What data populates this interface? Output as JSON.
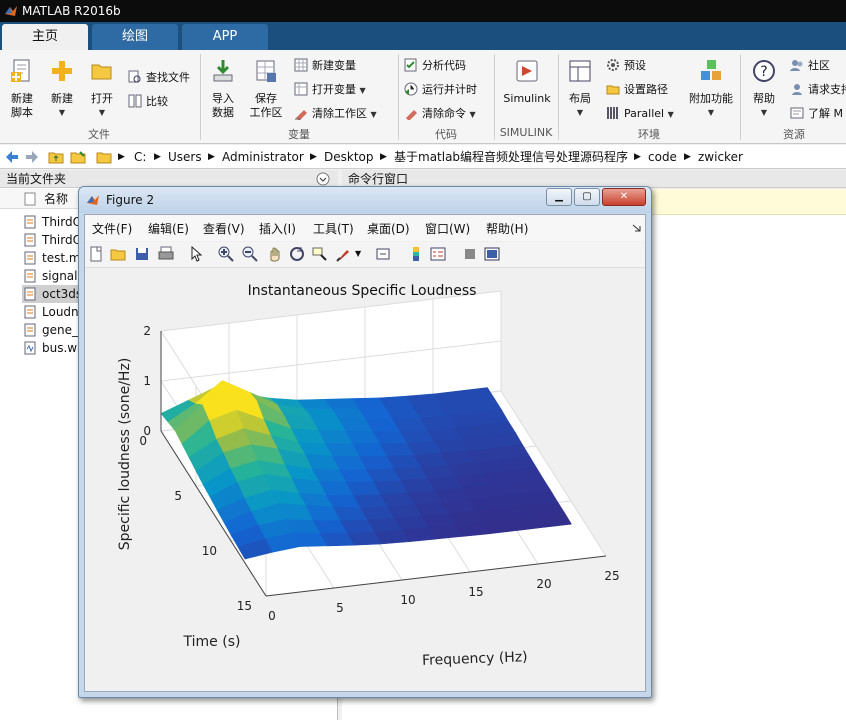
{
  "window": {
    "title": "MATLAB R2016b"
  },
  "tabs": [
    {
      "label": "主页",
      "active": true
    },
    {
      "label": "绘图",
      "active": false
    },
    {
      "label": "APP",
      "active": false
    }
  ],
  "ribbon": {
    "file": {
      "group_label": "文件",
      "new_script": [
        "新建",
        "脚本"
      ],
      "new": "新建",
      "open": "打开",
      "find_files": "查找文件",
      "compare": "比较"
    },
    "variable": {
      "group_label": "变量",
      "import": [
        "导入",
        "数据"
      ],
      "save_ws": [
        "保存",
        "工作区"
      ],
      "new_var": "新建变量",
      "open_var": "打开变量",
      "clear_ws": "清除工作区"
    },
    "code": {
      "group_label": "代码",
      "analyze": "分析代码",
      "run_time": "运行并计时",
      "clear_cmd": "清除命令"
    },
    "simulink": {
      "group_label": "SIMULINK",
      "label": "Simulink"
    },
    "env": {
      "group_label": "环境",
      "layout": "布局",
      "prefs": "预设",
      "set_path": "设置路径",
      "parallel": "Parallel",
      "addons": "附加功能"
    },
    "resources": {
      "group_label": "资源",
      "help": "帮助",
      "community": "社区",
      "request_support": "请求支持",
      "learn": "了解 M"
    }
  },
  "address": {
    "crumbs": [
      "C:",
      "Users",
      "Administrator",
      "Desktop",
      "基于matlab编程音频处理信号处理源码程序",
      "code",
      "zwicker"
    ]
  },
  "left_panel": {
    "title": "当前文件夹",
    "column_name": "名称",
    "files": [
      {
        "name": "ThirdO",
        "type": "m"
      },
      {
        "name": "ThirdO",
        "type": "m"
      },
      {
        "name": "test.m",
        "type": "m"
      },
      {
        "name": "signal",
        "type": "m"
      },
      {
        "name": "oct3ds",
        "type": "m",
        "selected": true
      },
      {
        "name": "Loudn",
        "type": "m"
      },
      {
        "name": "gene_",
        "type": "m"
      },
      {
        "name": "bus.wa",
        "type": "wav"
      }
    ]
  },
  "right_panel": {
    "title": "命令行窗口"
  },
  "figure": {
    "title": "Figure 2",
    "menus": [
      "文件(F)",
      "编辑(E)",
      "查看(V)",
      "插入(I)",
      "工具(T)",
      "桌面(D)",
      "窗口(W)",
      "帮助(H)"
    ],
    "toolbar_icons": [
      "new-figure-icon",
      "open-file-icon",
      "save-icon",
      "print-icon",
      "pointer-icon",
      "zoom-in-icon",
      "zoom-out-icon",
      "pan-icon",
      "rotate-icon",
      "data-cursor-icon",
      "brush-icon",
      "link-icon",
      "colorbar-icon",
      "legend-icon",
      "hide-plot-tools-icon",
      "show-plot-tools-icon"
    ]
  },
  "chart_data": {
    "type": "surface",
    "title": "Instantaneous Specific Loudness",
    "xlabel": "Frequency (Hz)",
    "ylabel": "Time (s)",
    "zlabel": "Specific loudness (sone/Hz)",
    "x_ticks": [
      0,
      5,
      10,
      15,
      20,
      25
    ],
    "y_ticks": [
      0,
      5,
      10,
      15
    ],
    "z_ticks": [
      0,
      1,
      2
    ],
    "xlim": [
      0,
      25
    ],
    "ylim": [
      0,
      15
    ],
    "zlim": [
      0,
      2
    ],
    "grid": true,
    "colormap": "parula",
    "x": [
      0,
      2,
      4,
      6,
      8,
      10,
      12,
      14,
      16,
      18,
      20,
      22,
      24
    ],
    "y": [
      0,
      1,
      2,
      3,
      4,
      5,
      6,
      7,
      8,
      9,
      10,
      11,
      12
    ],
    "z": [
      [
        0.35,
        0.55,
        0.75,
        0.55,
        0.4,
        0.3,
        0.25,
        0.2,
        0.15,
        0.12,
        0.1,
        0.1,
        0.1
      ],
      [
        0.4,
        0.7,
        1.1,
        0.8,
        0.5,
        0.35,
        0.28,
        0.22,
        0.16,
        0.12,
        0.1,
        0.1,
        0.1
      ],
      [
        0.45,
        0.9,
        1.2,
        0.85,
        0.5,
        0.4,
        0.3,
        0.22,
        0.15,
        0.12,
        0.1,
        0.1,
        0.1
      ],
      [
        0.4,
        0.8,
        0.95,
        0.7,
        0.45,
        0.35,
        0.28,
        0.2,
        0.14,
        0.1,
        0.08,
        0.08,
        0.08
      ],
      [
        0.35,
        0.65,
        0.8,
        0.6,
        0.4,
        0.3,
        0.24,
        0.18,
        0.12,
        0.1,
        0.08,
        0.08,
        0.08
      ],
      [
        0.3,
        0.6,
        0.7,
        0.55,
        0.38,
        0.28,
        0.2,
        0.15,
        0.1,
        0.08,
        0.06,
        0.06,
        0.06
      ],
      [
        0.25,
        0.5,
        0.6,
        0.45,
        0.3,
        0.22,
        0.16,
        0.12,
        0.08,
        0.06,
        0.05,
        0.05,
        0.05
      ],
      [
        0.22,
        0.45,
        0.55,
        0.4,
        0.28,
        0.2,
        0.14,
        0.1,
        0.07,
        0.05,
        0.04,
        0.04,
        0.04
      ],
      [
        0.18,
        0.35,
        0.45,
        0.32,
        0.22,
        0.15,
        0.1,
        0.07,
        0.05,
        0.04,
        0.03,
        0.03,
        0.03
      ],
      [
        0.15,
        0.3,
        0.4,
        0.3,
        0.2,
        0.12,
        0.08,
        0.06,
        0.04,
        0.03,
        0.03,
        0.03,
        0.03
      ],
      [
        0.12,
        0.25,
        0.3,
        0.22,
        0.15,
        0.1,
        0.07,
        0.05,
        0.03,
        0.02,
        0.02,
        0.02,
        0.02
      ],
      [
        0.1,
        0.2,
        0.25,
        0.18,
        0.12,
        0.08,
        0.05,
        0.04,
        0.02,
        0.02,
        0.02,
        0.02,
        0.02
      ],
      [
        0.08,
        0.15,
        0.2,
        0.15,
        0.1,
        0.06,
        0.04,
        0.03,
        0.02,
        0.01,
        0.01,
        0.01,
        0.01
      ]
    ]
  }
}
